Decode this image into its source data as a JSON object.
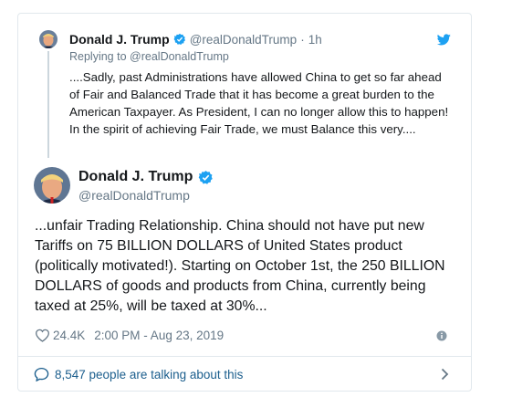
{
  "parent_tweet": {
    "display_name": "Donald J. Trump",
    "handle": "@realDonaldTrump",
    "separator": "·",
    "time": "1h",
    "replying_prefix": "Replying to",
    "replying_handle": "@realDonaldTrump",
    "text": "....Sadly, past Administrations have allowed China to get so far ahead of Fair and Balanced Trade that it has become a great burden to the American Taxpayer. As President, I can no longer allow this to happen! In the spirit of achieving Fair Trade, we must Balance this very...."
  },
  "main_tweet": {
    "display_name": "Donald J. Trump",
    "handle": "@realDonaldTrump",
    "text": "...unfair Trading Relationship. China should not have put new Tariffs on 75 BILLION DOLLARS of United States product (politically motivated!). Starting on October 1st, the 250 BILLION DOLLARS of goods and products from China, currently being taxed at 25%, will be taxed at 30%...",
    "likes": "24.4K",
    "timestamp": "2:00 PM - Aug 23, 2019"
  },
  "footer": {
    "talking_text": "8,547 people are talking about this"
  },
  "icons": {
    "brand": "twitter-bird-icon",
    "verified": "verified-badge-icon",
    "like": "heart-icon",
    "info": "info-icon",
    "conversation": "speech-bubble-icon",
    "more": "chevron-right-icon"
  },
  "colors": {
    "twitter_blue": "#1da1f2",
    "text": "#14171a",
    "secondary": "#657786",
    "link": "#1b5e8d",
    "border": "#e1e8ed"
  }
}
